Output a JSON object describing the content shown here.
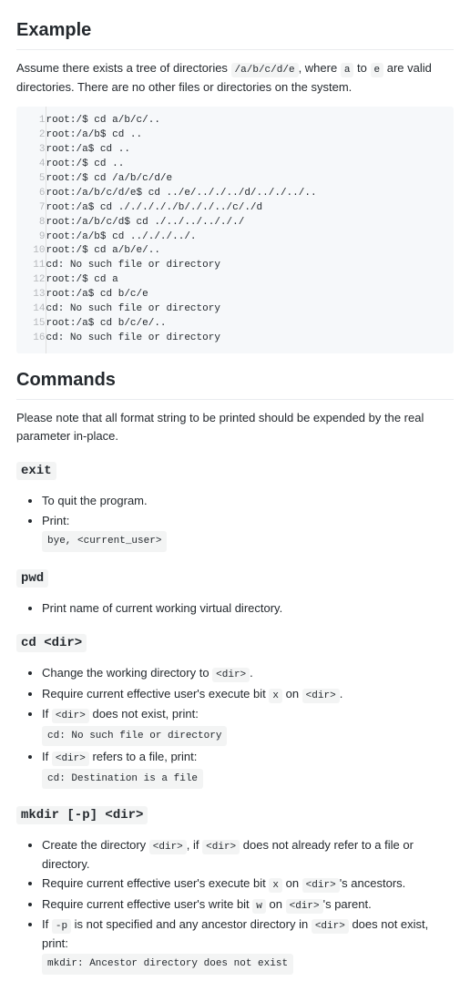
{
  "sections": {
    "example": {
      "heading": "Example",
      "intro_pre": "Assume there exists a tree of directories ",
      "intro_code1": "/a/b/c/d/e",
      "intro_mid1": ", where ",
      "intro_code2": "a",
      "intro_mid2": " to ",
      "intro_code3": "e",
      "intro_post": " are valid directories. There are no other files or directories on the system.",
      "code_lines": [
        "root:/$ cd a/b/c/..",
        "root:/a/b$ cd ..",
        "root:/a$ cd ..",
        "root:/$ cd ..",
        "root:/$ cd /a/b/c/d/e",
        "root:/a/b/c/d/e$ cd ../e/.././../d/.././../..",
        "root:/a$ cd ./././././b/././../c/./d",
        "root:/a/b/c/d$ cd ./../../../././",
        "root:/a/b$ cd ../././../.",
        "root:/$ cd a/b/e/..",
        "cd: No such file or directory",
        "root:/$ cd a",
        "root:/a$ cd b/c/e",
        "cd: No such file or directory",
        "root:/a$ cd b/c/e/..",
        "cd: No such file or directory"
      ]
    },
    "commands": {
      "heading": "Commands",
      "note": "Please note that all format string to be printed should be expended by the real parameter in-place."
    },
    "exit": {
      "heading": "exit",
      "item1": "To quit the program.",
      "item2": "Print:",
      "item2_code": "bye, <current_user>"
    },
    "pwd": {
      "heading": "pwd",
      "item1": "Print name of current working virtual directory."
    },
    "cd": {
      "heading": "cd <dir>",
      "item1_pre": "Change the working directory to ",
      "item1_code": "<dir>",
      "item1_post": ".",
      "item2_pre": "Require current effective user's execute bit ",
      "item2_code1": "x",
      "item2_mid": " on ",
      "item2_code2": "<dir>",
      "item2_post": ".",
      "item3_pre": "If ",
      "item3_code": "<dir>",
      "item3_post": " does not exist, print:",
      "item3_block": "cd: No such file or directory",
      "item4_pre": "If ",
      "item4_code": "<dir>",
      "item4_post": " refers to a file, print:",
      "item4_block": "cd: Destination is a file"
    },
    "mkdir": {
      "heading": "mkdir [-p] <dir>",
      "item1_pre": "Create the directory ",
      "item1_code1": "<dir>",
      "item1_mid": ", if ",
      "item1_code2": "<dir>",
      "item1_post": " does not already refer to a file or directory.",
      "item2_pre": "Require current effective user's execute bit ",
      "item2_code1": "x",
      "item2_mid": " on ",
      "item2_code2": "<dir>",
      "item2_post": "'s ancestors.",
      "item3_pre": "Require current effective user's write bit ",
      "item3_code1": "w",
      "item3_mid": " on ",
      "item3_code2": "<dir>",
      "item3_post": "'s parent.",
      "item4_pre": "If ",
      "item4_code1": "-p",
      "item4_mid": " is not specified and any ancestor directory in ",
      "item4_code2": "<dir>",
      "item4_post": " does not exist, print:",
      "item4_block": "mkdir: Ancestor directory does not exist"
    }
  }
}
